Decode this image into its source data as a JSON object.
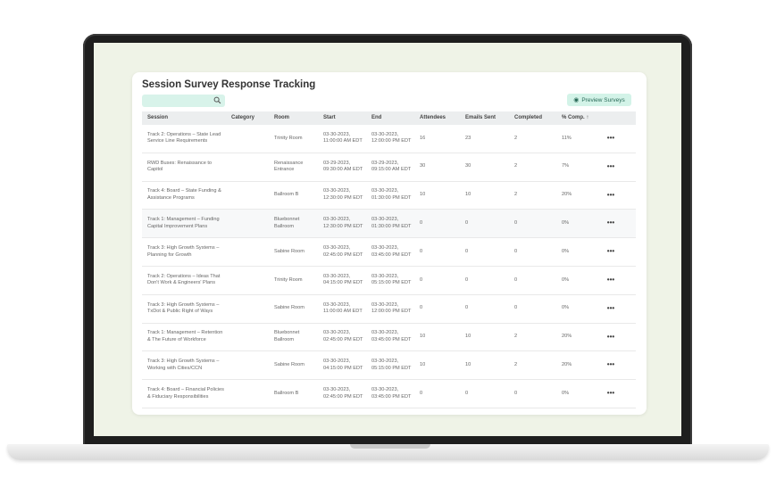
{
  "page": {
    "title": "Session Survey Response Tracking",
    "search_placeholder": "",
    "preview_button": "Preview Surveys"
  },
  "table": {
    "headers": {
      "session": "Session",
      "category": "Category",
      "room": "Room",
      "start": "Start",
      "end": "End",
      "attendees": "Attendees",
      "emails": "Emails Sent",
      "completed": "Completed",
      "pct": "% Comp.",
      "sort_indicator": "↑"
    },
    "rows": [
      {
        "session": "Track 2: Operations – State Lead Service Line Requirements",
        "category": "",
        "room": "Trinity Room",
        "start": "03-30-2023, 11:00:00 AM EDT",
        "end": "03-30-2023, 12:00:00 PM EDT",
        "attendees": "16",
        "emails": "23",
        "completed": "2",
        "pct": "11%",
        "menu": "•••"
      },
      {
        "session": "RWD Buses: Renaissance to Capitol",
        "category": "",
        "room": "Renaissance Entrance",
        "start": "03-29-2023, 09:30:00 AM EDT",
        "end": "03-29-2023, 09:15:00 AM EDT",
        "attendees": "30",
        "emails": "30",
        "completed": "2",
        "pct": "7%",
        "menu": "•••"
      },
      {
        "session": "Track 4: Board – State Funding & Assistance Programs",
        "category": "",
        "room": "Ballroom B",
        "start": "03-30-2023, 12:30:00 PM EDT",
        "end": "03-30-2023, 01:30:00 PM EDT",
        "attendees": "10",
        "emails": "10",
        "completed": "2",
        "pct": "20%",
        "menu": "•••"
      },
      {
        "session": "Track 1: Management – Funding Capital Improvement Plans",
        "category": "",
        "room": "Bluebonnet Ballroom",
        "start": "03-30-2023, 12:30:00 PM EDT",
        "end": "03-30-2023, 01:30:00 PM EDT",
        "attendees": "0",
        "emails": "0",
        "completed": "0",
        "pct": "0%",
        "menu": "•••"
      },
      {
        "session": "Track 3: High Growth Systems – Planning for Growth",
        "category": "",
        "room": "Sabine Room",
        "start": "03-30-2023, 02:45:00 PM EDT",
        "end": "03-30-2023, 03:45:00 PM EDT",
        "attendees": "0",
        "emails": "0",
        "completed": "0",
        "pct": "0%",
        "menu": "•••"
      },
      {
        "session": "Track 2: Operations – Ideas That Don't Work & Engineers' Plans",
        "category": "",
        "room": "Trinity Room",
        "start": "03-30-2023, 04:15:00 PM EDT",
        "end": "03-30-2023, 05:15:00 PM EDT",
        "attendees": "0",
        "emails": "0",
        "completed": "0",
        "pct": "0%",
        "menu": "•••"
      },
      {
        "session": "Track 3: High Growth Systems – TxDot & Public Right of Ways",
        "category": "",
        "room": "Sabine Room",
        "start": "03-30-2023, 11:00:00 AM EDT",
        "end": "03-30-2023, 12:00:00 PM EDT",
        "attendees": "0",
        "emails": "0",
        "completed": "0",
        "pct": "0%",
        "menu": "•••"
      },
      {
        "session": "Track 1: Management – Retention & The Future of Workforce",
        "category": "",
        "room": "Bluebonnet Ballroom",
        "start": "03-30-2023, 02:45:00 PM EDT",
        "end": "03-30-2023, 03:45:00 PM EDT",
        "attendees": "10",
        "emails": "10",
        "completed": "2",
        "pct": "20%",
        "menu": "•••"
      },
      {
        "session": "Track 3: High Growth Systems – Working with Cities/CCN",
        "category": "",
        "room": "Sabine Room",
        "start": "03-30-2023, 04:15:00 PM EDT",
        "end": "03-30-2023, 05:15:00 PM EDT",
        "attendees": "10",
        "emails": "10",
        "completed": "2",
        "pct": "20%",
        "menu": "•••"
      },
      {
        "session": "Track 4: Board – Financial Policies & Fiduciary Responsibilities",
        "category": "",
        "room": "Ballroom B",
        "start": "03-30-2023, 02:45:00 PM EDT",
        "end": "03-30-2023, 03:45:00 PM EDT",
        "attendees": "0",
        "emails": "0",
        "completed": "0",
        "pct": "0%",
        "menu": "•••"
      }
    ]
  },
  "colors": {
    "accent": "#d3f3e8",
    "screen_bg": "#eff3e7",
    "bezel": "#1e1e1e"
  }
}
